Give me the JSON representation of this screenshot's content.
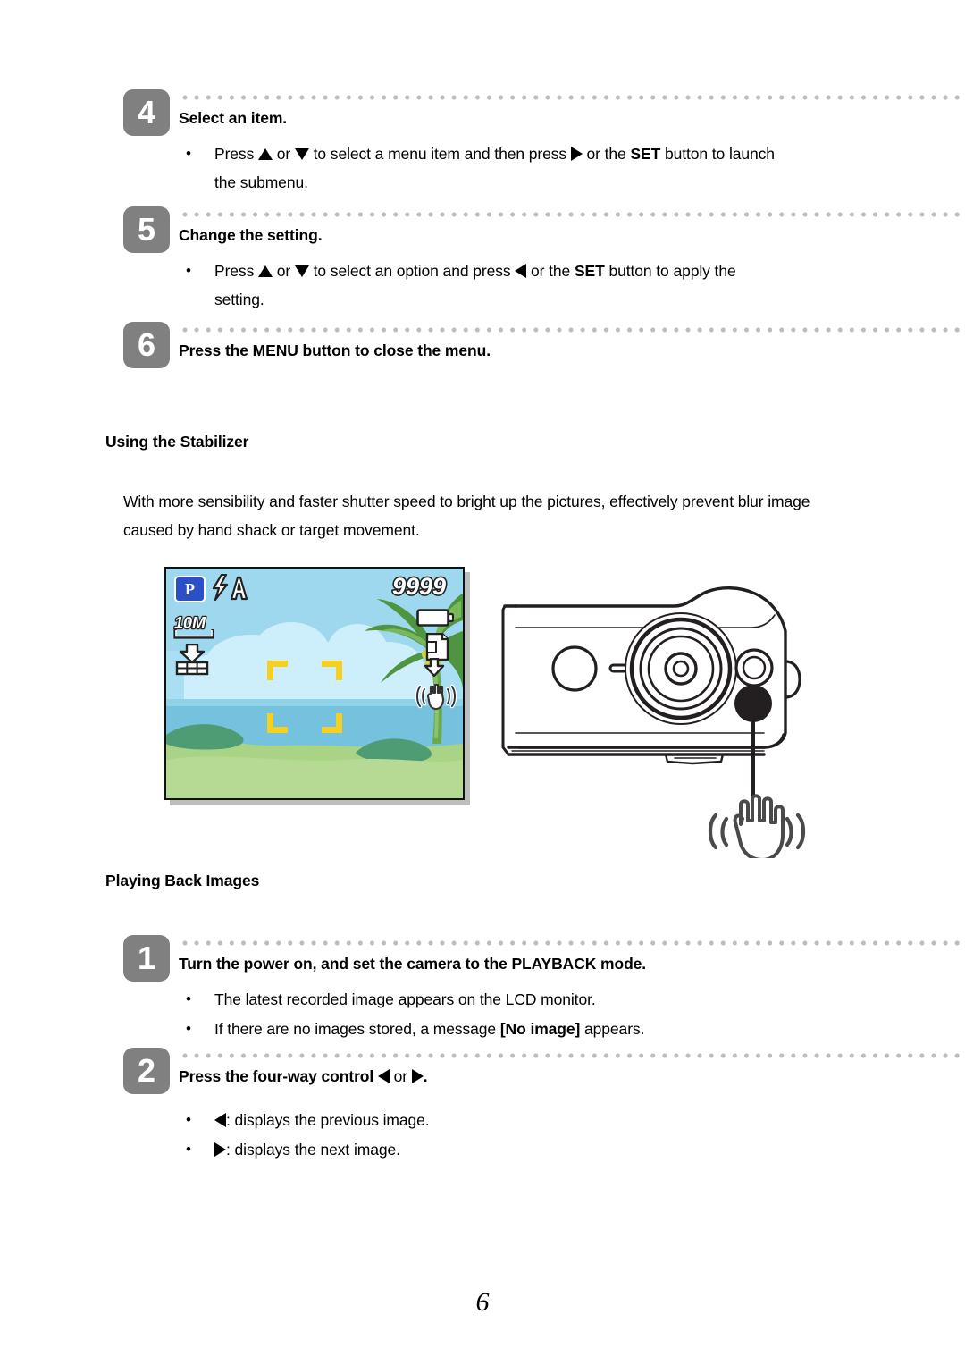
{
  "page": {
    "number": "6"
  },
  "steps_top": [
    {
      "badge": "4",
      "title": "Select an item.",
      "bullets": [
        {
          "pre": "Press ",
          "icon1": "triangle-up-icon",
          "mid1": " or ",
          "icon2": "triangle-down-icon",
          "mid2": " to select a menu item and then press ",
          "icon3": "triangle-right-icon",
          "mid3": " or the ",
          "bold": "SET",
          "post": " button to launch",
          "line2": "the submenu."
        }
      ]
    },
    {
      "badge": "5",
      "title": "Change the setting.",
      "bullets": [
        {
          "pre": "Press ",
          "icon1": "triangle-up-icon",
          "mid1": " or ",
          "icon2": "triangle-down-icon",
          "mid2": " to select an option and press ",
          "icon3": "triangle-left-icon",
          "mid3": " or the ",
          "bold": "SET",
          "post": " button to apply the",
          "line2": "setting."
        }
      ]
    },
    {
      "badge": "6",
      "title": "Press the MENU button to close the menu.",
      "bullets": []
    }
  ],
  "stabilizer": {
    "heading": "Using the Stabilizer",
    "body_line1": "With more sensibility and faster shutter speed to bright up the pictures, effectively prevent blur image",
    "body_line2": "caused by hand shack or target movement."
  },
  "lcd": {
    "mode_badge": "P",
    "flash_label": "A",
    "resolution": "10M",
    "shot_counter": "9999",
    "icons": [
      "program-mode-icon",
      "flash-auto-icon",
      "resolution-10m-icon",
      "quality-fine-icon",
      "battery-full-icon",
      "sd-card-icon",
      "stabilizer-hand-icon",
      "focus-bracket-icon"
    ]
  },
  "camera": {
    "icons": [
      "camera-top-body",
      "shutter-button",
      "lens-barrel",
      "stabilizer-button",
      "callout-line",
      "stabilizer-hand-icon"
    ]
  },
  "playback": {
    "heading": "Playing Back Images",
    "steps": [
      {
        "badge": "1",
        "title": "Turn the power on, and set the camera to the PLAYBACK mode.",
        "bullets": [
          "The latest recorded image appears on the LCD monitor.",
          {
            "pre": "If there are no images stored, a message ",
            "bold": "[No image]",
            "post": " appears."
          }
        ]
      },
      {
        "badge": "2",
        "title_pre": "Press the four-way control ",
        "title_icon1": "triangle-left-icon",
        "title_mid": " or ",
        "title_icon2": "triangle-right-icon",
        "title_post": ".",
        "bullets": [
          {
            "icon": "triangle-left-icon",
            "text": ": displays the previous image."
          },
          {
            "icon": "triangle-right-icon",
            "text": ": displays the next image."
          }
        ]
      }
    ]
  },
  "colors": {
    "badge_gray": "#808080",
    "dot_gray": "#bdbdbd",
    "lcd_sky": "#bfe6f5",
    "lcd_sea": "#6fbcd8",
    "lcd_grass": "#a8d385",
    "focus_yellow": "#f5d020",
    "mode_blue": "#2b4fc8"
  }
}
